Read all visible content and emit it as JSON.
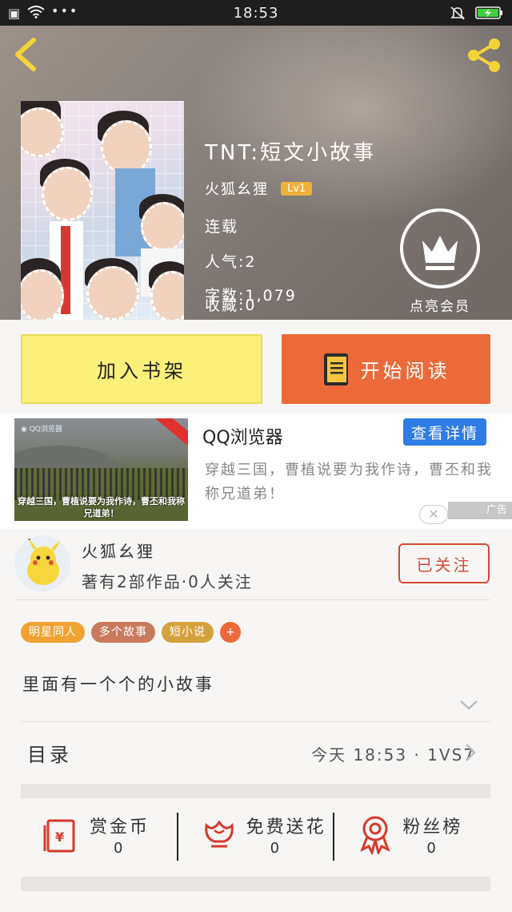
{
  "status_bar": {
    "time": "18:53"
  },
  "book": {
    "title": "TNT:短文小故事",
    "author": "火狐幺狸",
    "level": "Lv1",
    "status": "连载",
    "popularity": "人气:2",
    "word_count": "字数:1,079",
    "favorites": "收藏:0"
  },
  "vip": {
    "label": "点亮会员"
  },
  "actions": {
    "add_shelf": "加入书架",
    "start_reading": "开始阅读"
  },
  "ad": {
    "title": "QQ浏览器",
    "button": "查看详情",
    "description": "穿越三国，曹植说要为我作诗，曹丕和我称兄道弟！",
    "image_caption": "穿越三国，曹植说要为我作诗，曹丕和我称兄道弟！",
    "close": "✕",
    "tag": "广告"
  },
  "author_card": {
    "name": "火狐幺狸",
    "stats": "著有2部作品·0人关注",
    "follow_label": "已关注"
  },
  "tags": [
    {
      "label": "明星同人",
      "color": "#f0a233"
    },
    {
      "label": "多个故事",
      "color": "#c97a5c"
    },
    {
      "label": "短小说",
      "color": "#d4a23c"
    }
  ],
  "tag_add": "+",
  "summary": "里面有一个个的小故事",
  "toc": {
    "label": "目录",
    "latest": "今天 18:53 · 1VS7"
  },
  "rewards": [
    {
      "label": "赏金币",
      "count": "0",
      "icon": "red-envelope-icon"
    },
    {
      "label": "免费送花",
      "count": "0",
      "icon": "flower-icon"
    },
    {
      "label": "粉丝榜",
      "count": "0",
      "icon": "medal-icon"
    }
  ],
  "colors": {
    "accent": "#ec6a3a",
    "shelf_button": "#fbf079",
    "ad_button": "#2e7ce5",
    "follow": "#d24a36",
    "level_badge": "#f0b13a"
  }
}
